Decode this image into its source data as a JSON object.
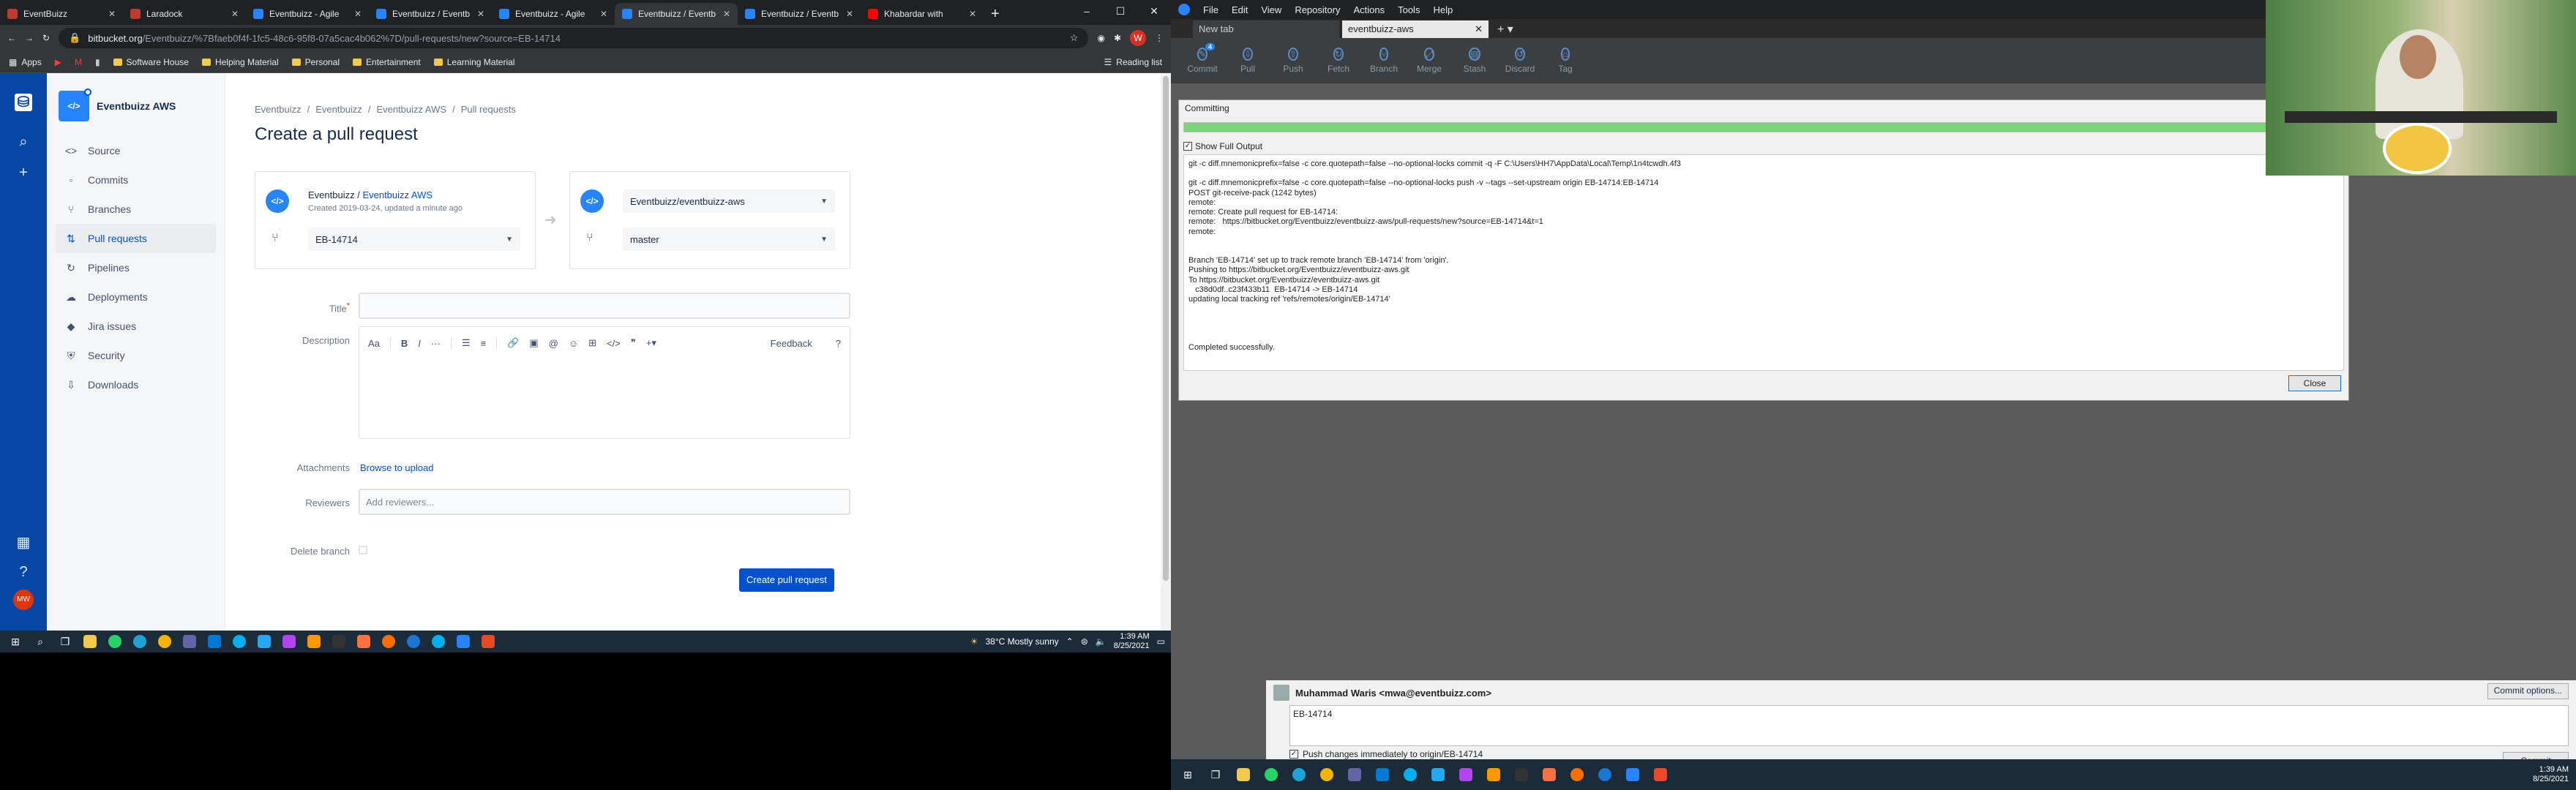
{
  "browser": {
    "tabs": [
      {
        "label": "EventBuizz",
        "color": "#c0392b",
        "active": false
      },
      {
        "label": "Laradock",
        "color": "#c0392b",
        "active": false
      },
      {
        "label": "Eventbuizz - Agile",
        "color": "#2684ff",
        "active": false
      },
      {
        "label": "Eventbuizz / Eventb",
        "color": "#2684ff",
        "active": false
      },
      {
        "label": "Eventbuizz - Agile",
        "color": "#2684ff",
        "active": false
      },
      {
        "label": "Eventbuizz / Eventb",
        "color": "#2684ff",
        "active": true
      },
      {
        "label": "Eventbuizz / Eventb",
        "color": "#2684ff",
        "active": false
      },
      {
        "label": "Khabardar with",
        "color": "#ff0000",
        "active": false
      }
    ],
    "url_host": "bitbucket.org",
    "url_path": "/Eventbuizz/%7Bfaeb0f4f-1fc5-48c6-95f8-07a5cac4b062%7D/pull-requests/new?source=EB-14714",
    "profile_initial": "W",
    "bookmarks": [
      "Apps",
      "Software House",
      "Helping Material",
      "Personal",
      "Entertainment",
      "Learning Material"
    ],
    "reading_list": "Reading list"
  },
  "repo": {
    "name": "Eventbuizz AWS"
  },
  "sidebar": {
    "items": [
      {
        "label": "Source",
        "icon": "<>"
      },
      {
        "label": "Commits",
        "icon": "◦"
      },
      {
        "label": "Branches",
        "icon": "⑂"
      },
      {
        "label": "Pull requests",
        "icon": "⇅"
      },
      {
        "label": "Pipelines",
        "icon": "↻"
      },
      {
        "label": "Deployments",
        "icon": "☁"
      },
      {
        "label": "Jira issues",
        "icon": "◆"
      },
      {
        "label": "Security",
        "icon": "⛨"
      },
      {
        "label": "Downloads",
        "icon": "⇩"
      }
    ],
    "active_index": 3
  },
  "global_nav": {
    "avatar_initials": "MW"
  },
  "breadcrumbs": [
    "Eventbuizz",
    "Eventbuizz",
    "Eventbuizz AWS",
    "Pull requests"
  ],
  "page_title": "Create a pull request",
  "source": {
    "owner": "Eventbuizz / ",
    "repo": "Eventbuizz AWS",
    "created": "Created 2019-03-24, updated a minute ago",
    "branch": "EB-14714"
  },
  "destination": {
    "repo": "Eventbuizz/eventbuizz-aws",
    "branch": "master"
  },
  "form": {
    "title_label": "Title",
    "description_label": "Description",
    "toolbar_text_style": "Aa",
    "feedback": "Feedback",
    "attachments_label": "Attachments",
    "browse": "Browse to upload",
    "reviewers_label": "Reviewers",
    "reviewers_placeholder": "Add reviewers...",
    "delete_branch_label": "Delete branch",
    "submit": "Create pull request"
  },
  "taskbar_left": {
    "weather": "38°C  Mostly sunny",
    "time": "1:39 AM",
    "date": "8/25/2021"
  },
  "sourcetree": {
    "menu": [
      "File",
      "Edit",
      "View",
      "Repository",
      "Actions",
      "Tools",
      "Help"
    ],
    "tabs": [
      "New tab",
      "eventbuizz-aws"
    ],
    "toolbar": [
      "Commit",
      "Pull",
      "Push",
      "Fetch",
      "Branch",
      "Merge",
      "Stash",
      "Discard",
      "Tag"
    ],
    "commit_badge": "4",
    "dialog": {
      "title": "Committing",
      "progress": 1.0,
      "show_full_output": "Show Full Output",
      "log_lines": [
        "git -c diff.mnemonicprefix=false -c core.quotepath=false --no-optional-locks commit -q -F C:\\Users\\HH7\\AppData\\Local\\Temp\\1n4tcwdh.4f3",
        "",
        "git -c diff.mnemonicprefix=false -c core.quotepath=false --no-optional-locks push -v --tags --set-upstream origin EB-14714:EB-14714",
        "POST git-receive-pack (1242 bytes)",
        "remote:",
        "remote: Create pull request for EB-14714:",
        "remote:   https://bitbucket.org/Eventbuizz/eventbuizz-aws/pull-requests/new?source=EB-14714&t=1",
        "remote:",
        "",
        "",
        "Branch 'EB-14714' set up to track remote branch 'EB-14714' from 'origin'.",
        "Pushing to https://bitbucket.org/Eventbuizz/eventbuizz-aws.git",
        "To https://bitbucket.org/Eventbuizz/eventbuizz-aws.git",
        "   c38d0df..c23f433b11  EB-14714 -> EB-14714",
        "updating local tracking ref 'refs/remotes/origin/EB-14714'",
        "",
        "",
        "",
        "",
        "Completed successfully."
      ],
      "close": "Close"
    },
    "commit_author": "Muhammad Waris <mwa@eventbuizz.com>",
    "commit_message": "EB-14714",
    "commit_options": "Commit options...",
    "push_immediately": "Push changes immediately to origin/EB-14714",
    "commit_button": "Commit"
  },
  "taskbar_right": {
    "time": "1:39 AM",
    "date": "8/25/2021"
  }
}
